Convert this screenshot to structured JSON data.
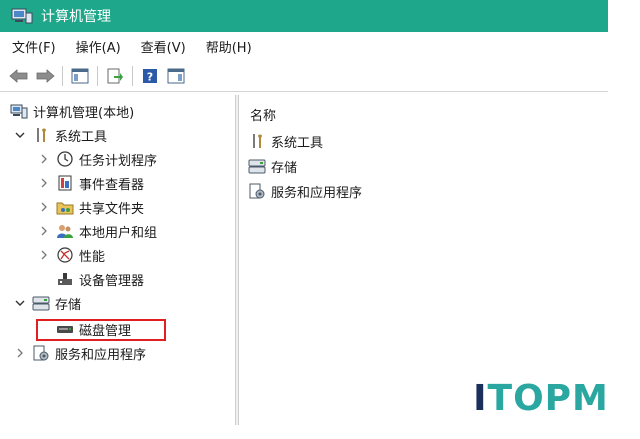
{
  "window": {
    "title": "计算机管理"
  },
  "menu": [
    "文件(F)",
    "操作(A)",
    "查看(V)",
    "帮助(H)"
  ],
  "toolbar": {
    "buttons": [
      "back-arrow-icon",
      "forward-arrow-icon",
      "show-console-tree-icon",
      "export-list-icon",
      "help-icon",
      "show-action-pane-icon"
    ]
  },
  "tree": {
    "root": "计算机管理(本地)",
    "system_tools": "系统工具",
    "task_scheduler": "任务计划程序",
    "event_viewer": "事件查看器",
    "shared_folders": "共享文件夹",
    "local_users_groups": "本地用户和组",
    "performance": "性能",
    "device_manager": "设备管理器",
    "storage": "存储",
    "disk_management": "磁盘管理",
    "services_apps": "服务和应用程序"
  },
  "content": {
    "column_header": "名称",
    "items": [
      "系统工具",
      "存储",
      "服务和应用程序"
    ]
  },
  "watermark": {
    "first": "I",
    "rest": "TOPM"
  },
  "colors": {
    "titlebar": "#1ea78a",
    "highlight": "#e02020"
  }
}
